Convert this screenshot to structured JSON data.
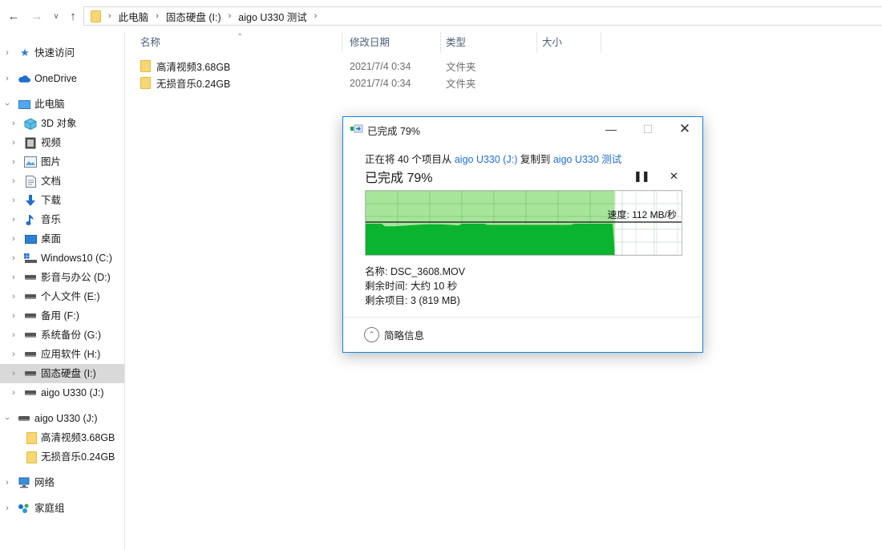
{
  "breadcrumbs": [
    {
      "label": "此电脑"
    },
    {
      "label": "固态硬盘 (I:)"
    },
    {
      "label": "aigo U330 测试"
    }
  ],
  "columns": {
    "name": "名称",
    "date": "修改日期",
    "type": "类型",
    "size": "大小"
  },
  "files": [
    {
      "name": "高清视频3.68GB",
      "date": "2021/7/4 0:34",
      "type": "文件夹",
      "size": ""
    },
    {
      "name": "无损音乐0.24GB",
      "date": "2021/7/4 0:34",
      "type": "文件夹",
      "size": ""
    }
  ],
  "sidebar": {
    "quick_access": "快速访问",
    "onedrive": "OneDrive",
    "this_pc": "此电脑",
    "pc_items": [
      {
        "label": "3D 对象",
        "icon": "3d-objects-icon"
      },
      {
        "label": "视频",
        "icon": "videos-icon"
      },
      {
        "label": "图片",
        "icon": "pictures-icon"
      },
      {
        "label": "文档",
        "icon": "documents-icon"
      },
      {
        "label": "下载",
        "icon": "downloads-icon"
      },
      {
        "label": "音乐",
        "icon": "music-icon"
      },
      {
        "label": "桌面",
        "icon": "desktop-icon"
      },
      {
        "label": "Windows10 (C:)",
        "icon": "system-drive-icon"
      },
      {
        "label": "影音与办公 (D:)",
        "icon": "drive-icon"
      },
      {
        "label": "个人文件 (E:)",
        "icon": "drive-icon"
      },
      {
        "label": "备用 (F:)",
        "icon": "drive-icon"
      },
      {
        "label": "系统备份 (G:)",
        "icon": "drive-icon"
      },
      {
        "label": "应用软件 (H:)",
        "icon": "drive-icon"
      },
      {
        "label": "固态硬盘 (I:)",
        "icon": "drive-icon",
        "selected": true
      },
      {
        "label": "aigo U330 (J:)",
        "icon": "drive-icon"
      }
    ],
    "usb_drive": "aigo U330 (J:)",
    "usb_children": [
      "高清视频3.68GB",
      "无损音乐0.24GB"
    ],
    "network": "网络",
    "homegroup": "家庭组"
  },
  "dialog": {
    "title": "已完成 79%",
    "line_prefix": "正在将 40 个项目从",
    "source": "aigo U330 (J:)",
    "line_middle": "复制到",
    "destination": "aigo U330 测试",
    "big_status": "已完成 79%",
    "progress_fraction": 0.79,
    "speed_label": "速度: 112 MB/秒",
    "name_line": "名称: DSC_3608.MOV",
    "time_line": "剩余时间: 大约 10 秒",
    "items_line": "剩余项目: 3 (819 MB)",
    "details_toggle": "简略信息",
    "pause_icon": "pause-icon",
    "cancel_icon": "close-icon"
  },
  "colors": {
    "accent": "#1883d7",
    "link": "#1f6fce",
    "progress_light": "#a6e59a",
    "progress_dark": "#0ab42f",
    "selection": "#d9d9d9"
  }
}
